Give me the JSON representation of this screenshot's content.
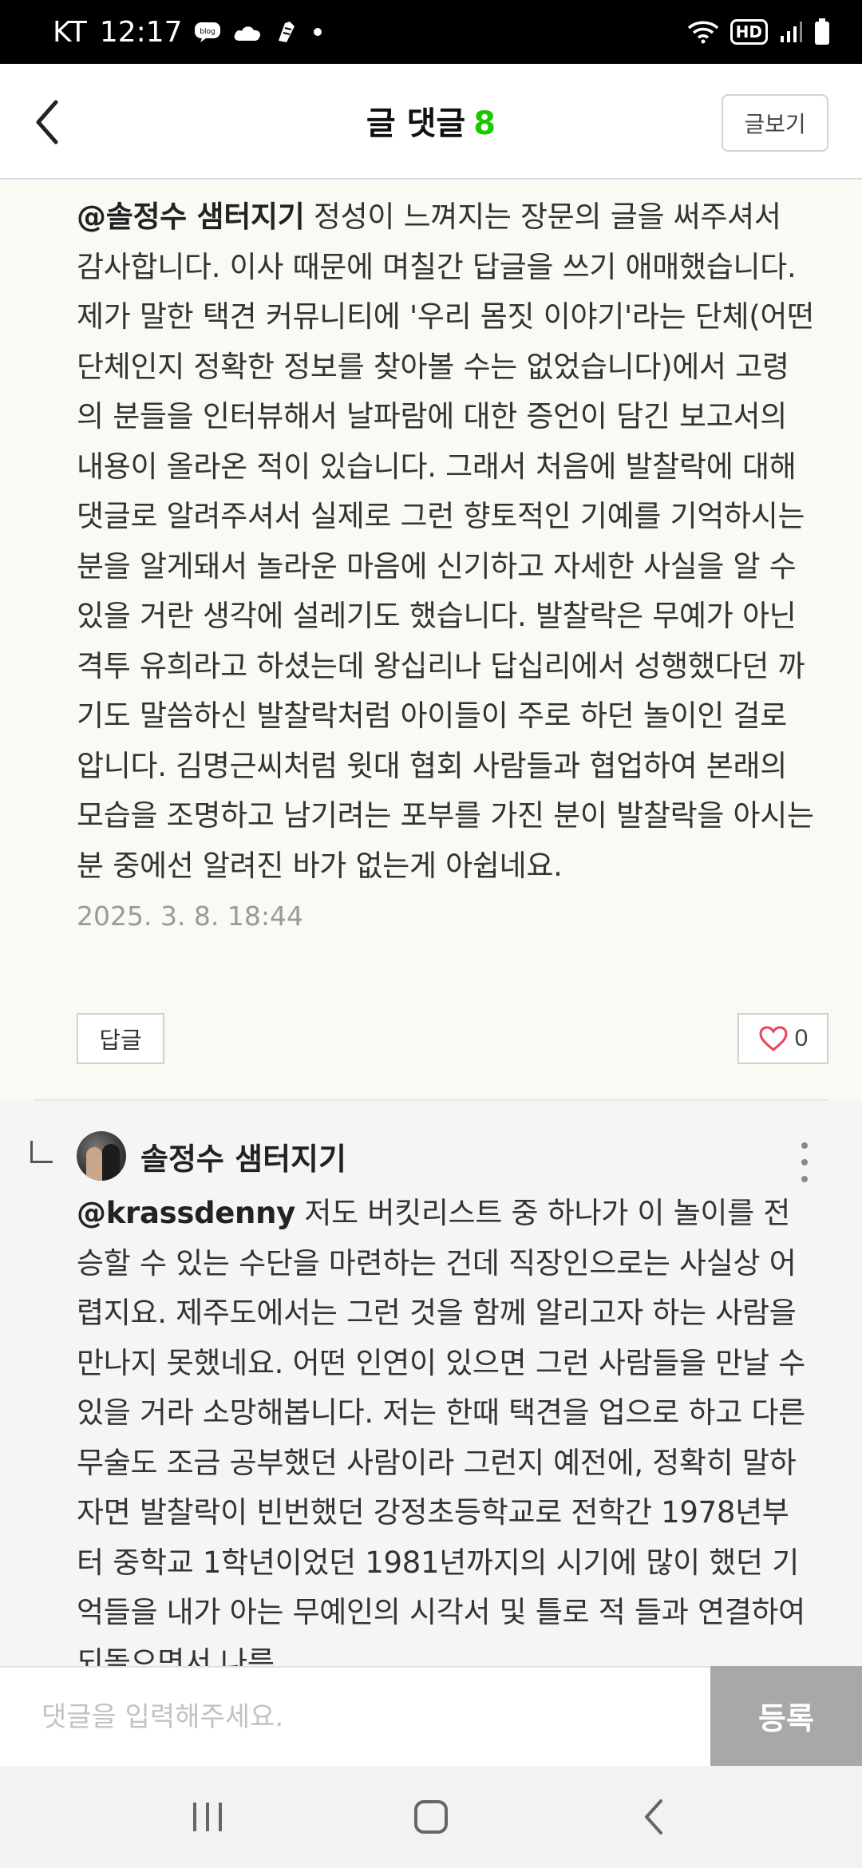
{
  "status_bar": {
    "carrier": "KT",
    "time": "12:17",
    "icons": [
      "blog-icon",
      "cloud-icon",
      "app-icon",
      "dot-icon",
      "wifi-icon",
      "hd-icon",
      "signal-icon",
      "battery-icon"
    ],
    "hd_label": "HD"
  },
  "header": {
    "title": "글 댓글",
    "count": "8",
    "view_post_label": "글보기"
  },
  "comment_1": {
    "mention": "@솔정수 샘터지기",
    "text": " 정성이 느껴지는 장문의 글을 써주셔서 감사합니다. 이사 때문에 며칠간 답글을 쓰기 애매했습니다. 제가 말한 택견 커뮤니티에 '우리 몸짓 이야기'라는 단체(어떤 단체인지 정확한 정보를 찾아볼 수는 없었습니다)에서 고령의 분들을 인터뷰해서 날파람에 대한 증언이 담긴 보고서의 내용이 올라온 적이 있습니다. 그래서 처음에 발찰락에 대해 댓글로 알려주셔서 실제로 그런 향토적인 기예를 기억하시는 분을 알게돼서 놀라운 마음에 신기하고 자세한 사실을 알 수 있을 거란 생각에 설레기도 했습니다. 발찰락은 무예가 아닌 격투 유희라고 하셨는데 왕십리나 답십리에서 성행했다던 까기도 말씀하신 발찰락처럼 아이들이 주로 하던 놀이인 걸로 압니다. 김명근씨처럼 윗대 협회 사람들과 협업하여 본래의 모습을 조명하고 남기려는 포부를 가진 분이 발찰락을 아시는 분 중에선 알려진 바가 없는게 아쉽네요.",
    "date": "2025. 3. 8. 18:44",
    "reply_label": "답글",
    "like_count": "0"
  },
  "comment_2": {
    "author": "솔정수 샘터지기",
    "mention": "@krassdenny",
    "text": " 저도 버킷리스트 중 하나가 이 놀이를 전승할 수 있는 수단을 마련하는 건데 직장인으로는 사실상 어렵지요. 제주도에서는 그런 것을 함께 알리고자 하는 사람을 만나지 못했네요. 어떤 인연이 있으면 그런 사람들을 만날 수 있을 거라 소망해봅니다. 저는 한때 택견을 업으로 하고 다른 무술도 조금 공부했던 사람이라 그런지 예전에, 정확히 말하자면 발찰락이 빈번했던 강정초등학교로 전학간 1978년부터 중학교 1학년이었던 1981년까지의 시기에 많이 했던 기억들을 내가 아는 무예인의 시각서 및 틀로 적 들과 연결하여 되돌으면서 나름"
  },
  "input_bar": {
    "placeholder": "댓글을 입력해주세요.",
    "submit_label": "등록"
  },
  "nav_bar": {
    "icons": [
      "recent-apps-icon",
      "home-icon",
      "back-icon"
    ]
  },
  "colors": {
    "accent_green": "#1ec800",
    "like_heart": "#e8445a",
    "submit_bg": "#a8a8a8"
  }
}
